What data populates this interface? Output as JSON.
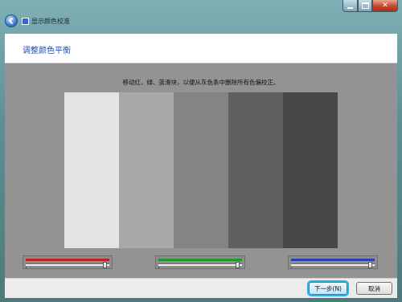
{
  "window": {
    "title": "显示颜色校准"
  },
  "header": {
    "title": "调整颜色平衡"
  },
  "instruction": "移动红、绿、蓝滑块，以便从灰色条中删除所有色偏校正。",
  "gray_bars": [
    {
      "color": "#e4e4e4"
    },
    {
      "color": "#a8a8a8"
    },
    {
      "color": "#848484"
    },
    {
      "color": "#5f5f5f"
    },
    {
      "color": "#484848"
    }
  ],
  "sliders": [
    {
      "name": "red",
      "color": "#c21f1f",
      "value_fraction": 0.97
    },
    {
      "name": "green",
      "color": "#1f9a2a",
      "value_fraction": 0.97
    },
    {
      "name": "blue",
      "color": "#2a3fb8",
      "value_fraction": 0.97
    }
  ],
  "footer": {
    "next_label": "下一步(N)",
    "cancel_label": "取消"
  },
  "icons": {
    "back": "back-arrow-icon",
    "minimize": "minimize-icon",
    "maximize": "maximize-icon",
    "close": "close-icon"
  }
}
